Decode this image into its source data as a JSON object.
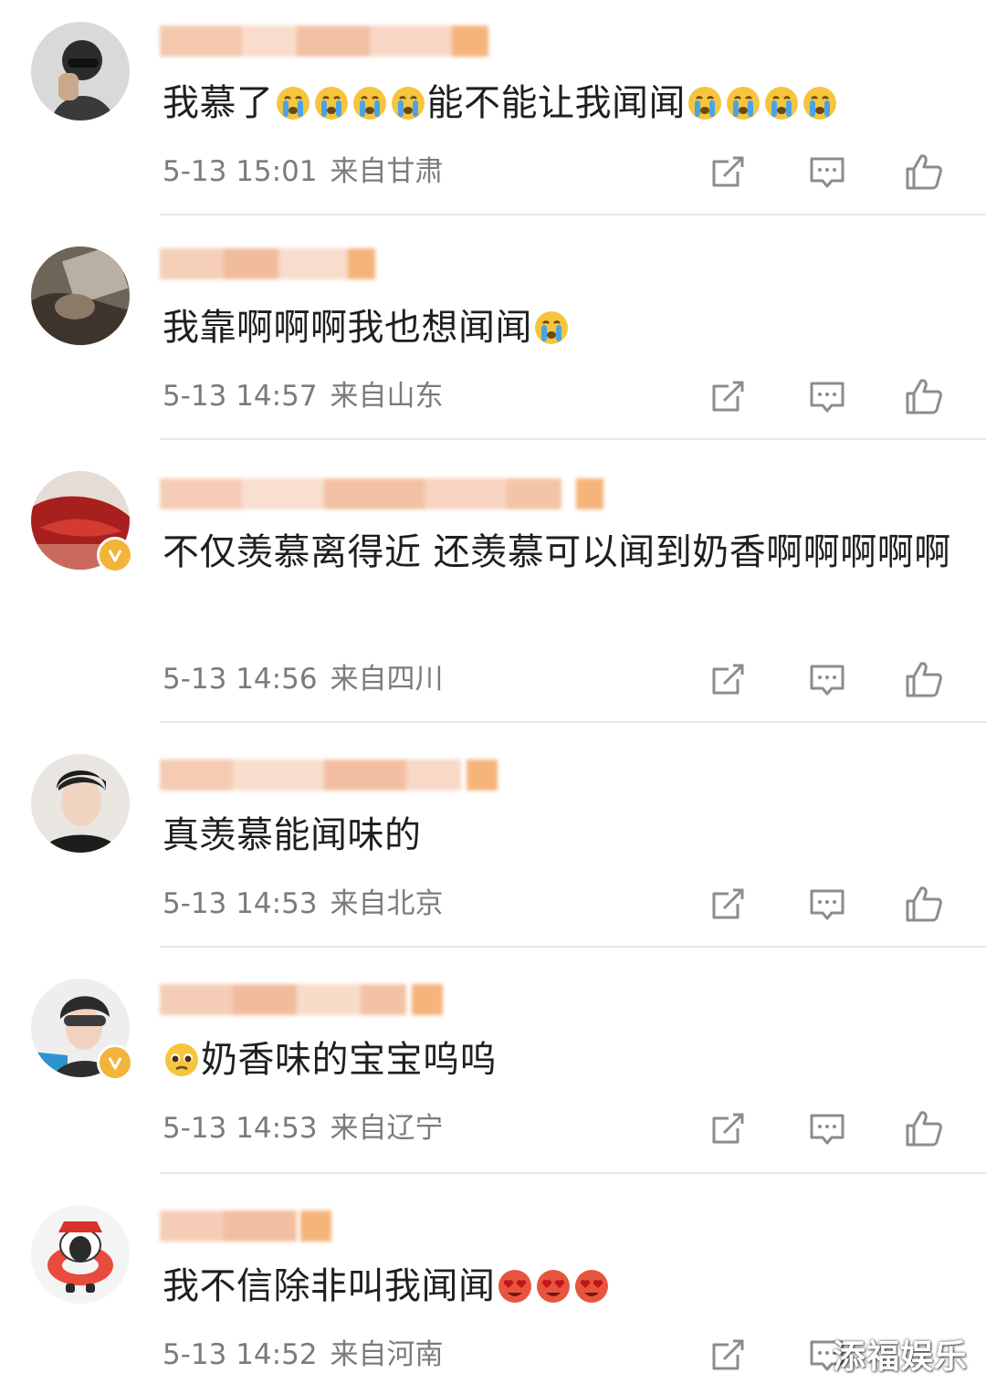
{
  "comments": [
    {
      "text_parts": [
        "我慕了",
        "{cry}",
        "{cry}",
        "{cry}",
        "{cry}",
        "能不能让我闻闻",
        "{cry}",
        "{cry}",
        "{cry}",
        "{cry}"
      ],
      "time": "5-13 15:01",
      "location": "来自甘肃",
      "verified": false
    },
    {
      "text_parts": [
        "我靠啊啊啊我也想闻闻",
        "{cry}"
      ],
      "time": "5-13 14:57",
      "location": "来自山东",
      "verified": false
    },
    {
      "text_parts": [
        "不仅羡慕离得近 还羡慕可以闻到奶香啊啊啊啊啊"
      ],
      "time": "5-13 14:56",
      "location": "来自四川",
      "verified": true
    },
    {
      "text_parts": [
        "真羡慕能闻味的"
      ],
      "time": "5-13 14:53",
      "location": "来自北京",
      "verified": false
    },
    {
      "text_parts": [
        "{plead}",
        "奶香味的宝宝呜呜"
      ],
      "time": "5-13 14:53",
      "location": "来自辽宁",
      "verified": true
    },
    {
      "text_parts": [
        "我不信除非叫我闻闻",
        "{love}",
        "{love}",
        "{love}"
      ],
      "time": "5-13 14:52",
      "location": "来自河南",
      "verified": false
    }
  ],
  "c0": {
    "time": "5-13 15:01",
    "location": "来自甘肃",
    "text_a": "我慕了",
    "text_b": "能不能让我闻闻"
  },
  "c1": {
    "time": "5-13 14:57",
    "location": "来自山东",
    "text_a": "我靠啊啊啊我也想闻闻"
  },
  "c2": {
    "time": "5-13 14:56",
    "location": "来自四川",
    "text_a": "不仅羡慕离得近 还羡慕可以闻到奶香啊啊啊啊啊"
  },
  "c3": {
    "time": "5-13 14:53",
    "location": "来自北京",
    "text_a": "真羡慕能闻味的"
  },
  "c4": {
    "time": "5-13 14:53",
    "location": "来自辽宁",
    "text_a": "奶香味的宝宝呜呜"
  },
  "c5": {
    "time": "5-13 14:52",
    "location": "来自河南",
    "text_a": "我不信除非叫我闻闻"
  },
  "icons": {
    "share": "edit-share-icon",
    "reply": "comment-bubble-icon",
    "like": "thumbs-up-icon",
    "verified": "verified-v-badge-icon"
  },
  "colors": {
    "meta_text": "#7b7b7b",
    "body_text": "#1f1f1f",
    "divider": "#e7e7e7",
    "verified_badge": "#f3b43a",
    "username_blur": "#f3c4a8"
  },
  "watermark": "添福娱乐"
}
